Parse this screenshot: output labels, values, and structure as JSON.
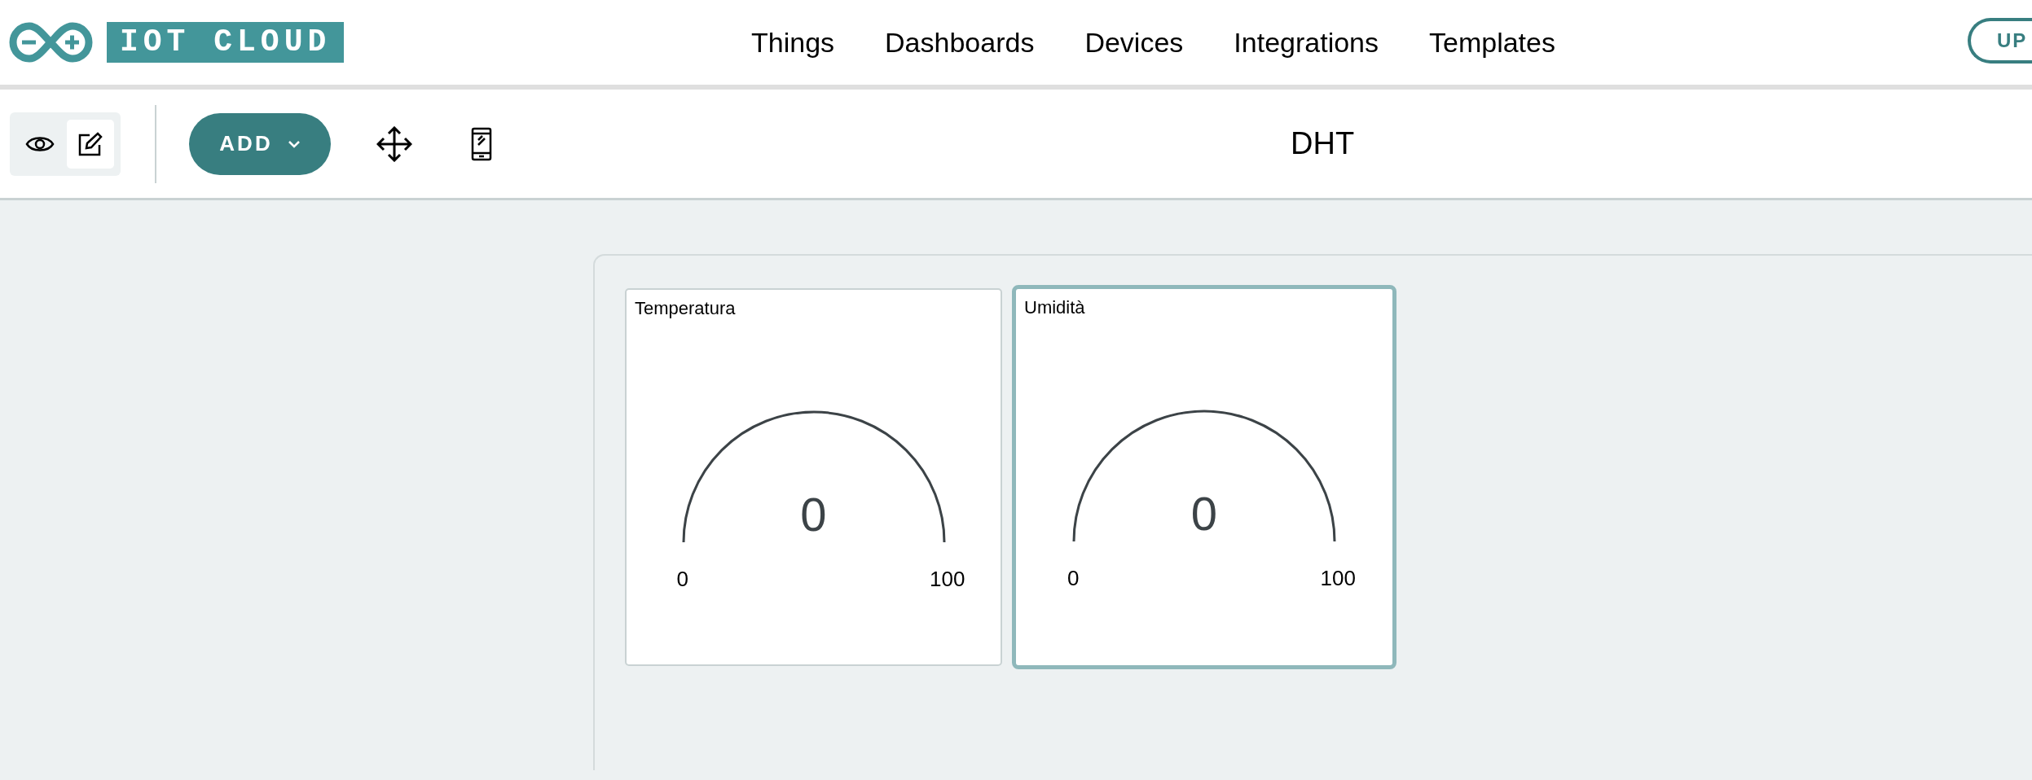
{
  "logo": {
    "text": "IOT CLOUD"
  },
  "nav": [
    {
      "label": "Things"
    },
    {
      "label": "Dashboards"
    },
    {
      "label": "Devices"
    },
    {
      "label": "Integrations"
    },
    {
      "label": "Templates"
    }
  ],
  "upgrade_button": {
    "label": "UP"
  },
  "mode_toggle": [
    {
      "kind": "view",
      "selected": false
    },
    {
      "kind": "edit",
      "selected": true
    }
  ],
  "add_button": {
    "label": "ADD"
  },
  "dashboard_title": "DHT",
  "widgets": [
    {
      "title": "Temperatura",
      "value": "0",
      "min": "0",
      "max": "100",
      "selected": false
    },
    {
      "title": "Umidità",
      "value": "0",
      "min": "0",
      "max": "100",
      "selected": true
    }
  ]
}
